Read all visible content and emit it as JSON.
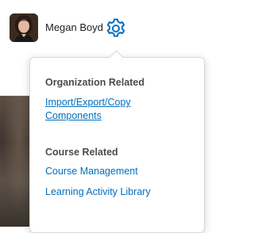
{
  "header": {
    "user_name": "Megan Boyd",
    "avatar_icon": "user-avatar-photo",
    "settings_icon": "gear-icon",
    "accent_color": "#006fbf"
  },
  "menu": {
    "sections": [
      {
        "heading": "Organization Related",
        "links": [
          "Import/Export/Copy Components"
        ]
      },
      {
        "heading": "Course Related",
        "links": [
          "Course Management",
          "Learning Activity Library"
        ]
      }
    ]
  }
}
